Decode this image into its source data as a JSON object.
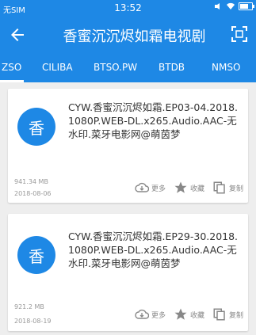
{
  "status_bar": {
    "carrier": "无SIM",
    "time": "13:52"
  },
  "app_bar": {
    "title": "香蜜沉沉烬如霜电视剧",
    "back_icon": "back-arrow-icon",
    "scan_icon": "scan-icon"
  },
  "tabs": [
    {
      "label": "ZSO"
    },
    {
      "label": "CILIBA"
    },
    {
      "label": "BTSO.PW"
    },
    {
      "label": "BTDB"
    },
    {
      "label": "NMSO"
    }
  ],
  "results": [
    {
      "avatar": "香",
      "title": "CYW.香蜜沉沉烬如霜.EP03-04.2018.1080P.WEB-DL.x265.Audio.AAC-无水印.菜牙电影网@萌茵梦",
      "size": "941.34 MB",
      "date": "2018-08-06",
      "actions": {
        "more": "更多",
        "favorite": "收藏",
        "copy": "复制"
      }
    },
    {
      "avatar": "香",
      "title": "CYW.香蜜沉沉烬如霜.EP29-30.2018.1080P.WEB-DL.x265.Audio.AAC-无水印.菜牙电影网@萌茵梦",
      "size": "921.2 MB",
      "date": "2018-08-19",
      "actions": {
        "more": "更多",
        "favorite": "收藏",
        "copy": "复制"
      }
    }
  ],
  "colors": {
    "primary": "#1e88e5",
    "background": "#eeeeee"
  }
}
